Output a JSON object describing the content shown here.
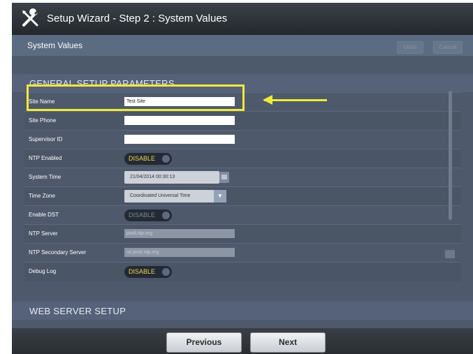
{
  "window": {
    "title": "Setup Wizard - Step 2 : System Values",
    "icon": "wrench-screwdriver-icon"
  },
  "subheader": {
    "title": "System Values",
    "undo_label": "Undo",
    "cancel_label": "Cancel"
  },
  "sections": {
    "general": {
      "title": "GENERAL SETUP PARAMETERS"
    },
    "web": {
      "title": "WEB SERVER SETUP"
    }
  },
  "fields": {
    "site_name": {
      "label": "Site Name",
      "value": "Test Site"
    },
    "site_phone": {
      "label": "Site Phone",
      "value": ""
    },
    "supervisor_id": {
      "label": "Supervisor ID",
      "value": ""
    },
    "ntp_enabled": {
      "label": "NTP Enabled",
      "value": "DISABLE"
    },
    "system_time": {
      "label": "System Time",
      "value": "21/04/2014 00:30:13"
    },
    "time_zone": {
      "label": "Time Zone",
      "value": "Coordinated Universal Time"
    },
    "enable_dst": {
      "label": "Enable DST",
      "value": "DISABLE"
    },
    "ntp_server": {
      "label": "NTP Server",
      "value": "pool.ntp.org"
    },
    "ntp_secondary": {
      "label": "NTP Secondary Server",
      "value": "us.pool.ntp.org"
    },
    "debug_log": {
      "label": "Debug Log",
      "value": "DISABLE"
    }
  },
  "footer": {
    "previous_label": "Previous",
    "next_label": "Next"
  },
  "colors": {
    "highlight": "#f0ea38",
    "toggle_text": "#f1d64a",
    "panel": "#4e5a6b"
  }
}
